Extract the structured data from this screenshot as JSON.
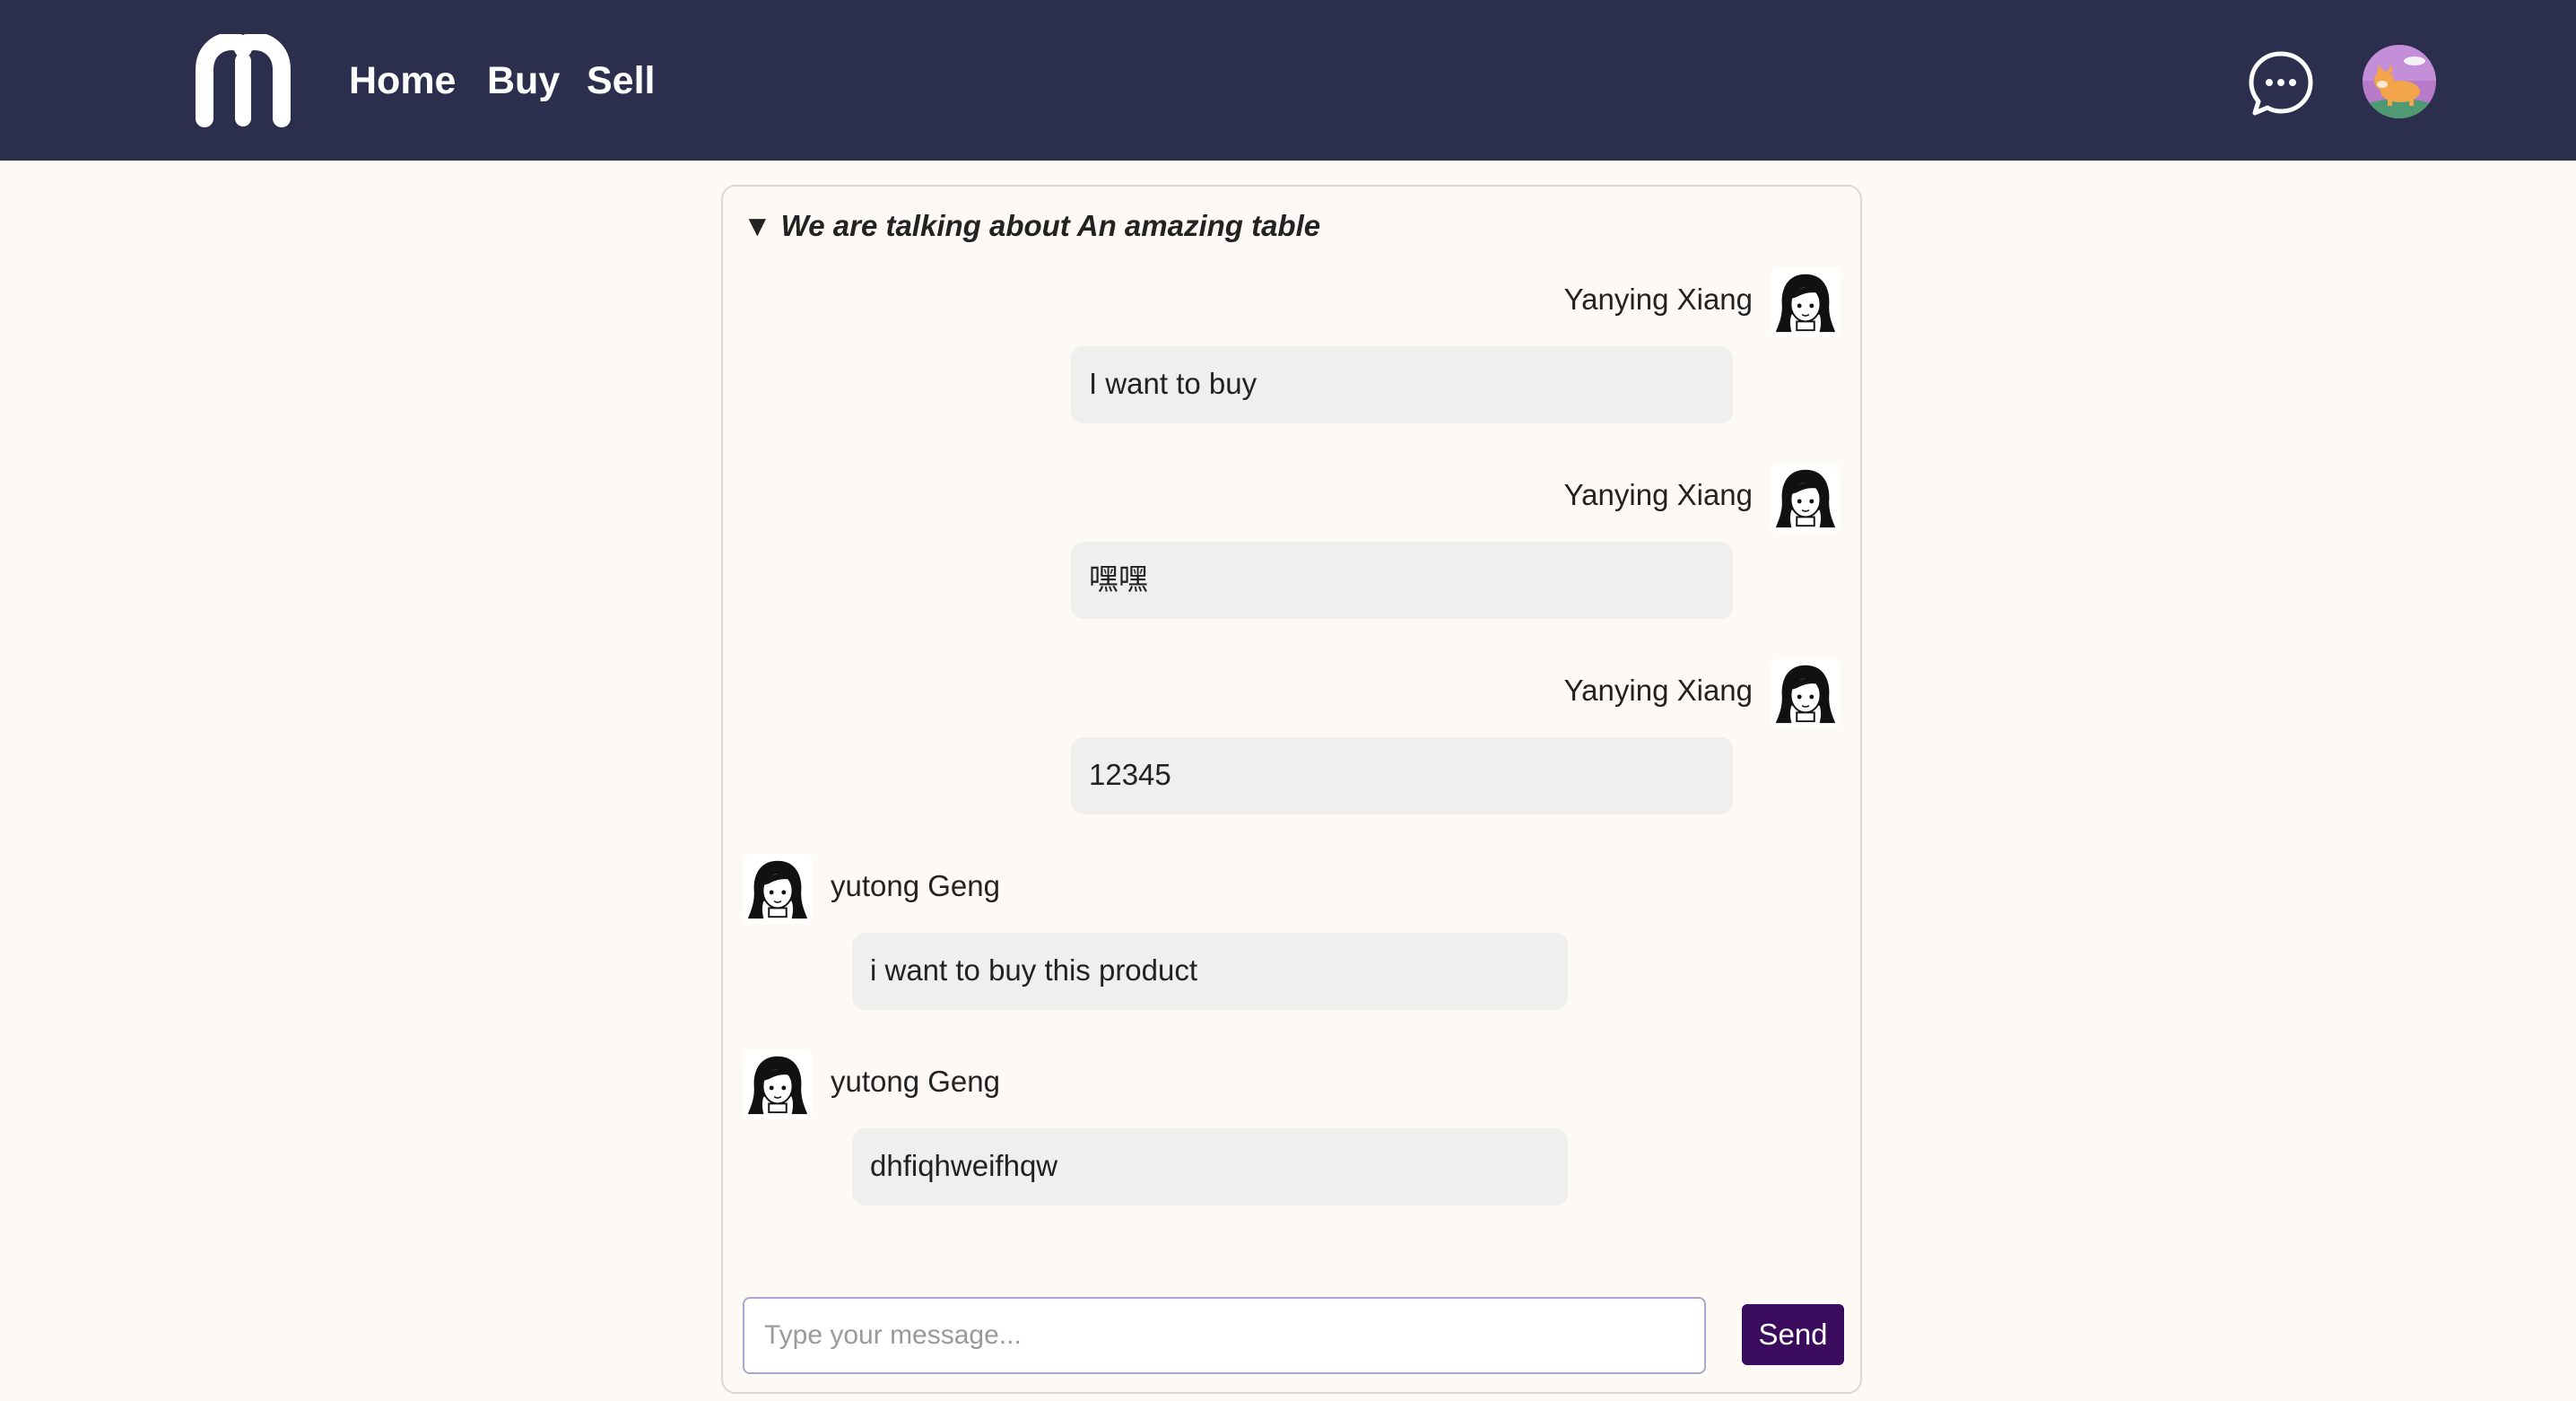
{
  "nav": {
    "links": [
      {
        "label": "Home"
      },
      {
        "label": "Buy"
      },
      {
        "label": "Sell"
      }
    ],
    "logo_icon": "m-logo-icon",
    "chat_icon": "chat-bubble-icon",
    "avatar_icon": "corgi-avatar"
  },
  "chat": {
    "title": "We are talking about An amazing table",
    "title_toggle": "▼",
    "messages": [
      {
        "sender": "Yanying Xiang",
        "text": "I want to buy",
        "side": "right"
      },
      {
        "sender": "Yanying Xiang",
        "text": "嘿嘿",
        "side": "right"
      },
      {
        "sender": "Yanying Xiang",
        "text": "12345",
        "side": "right"
      },
      {
        "sender": "yutong Geng",
        "text": "i want to buy this product",
        "side": "left"
      },
      {
        "sender": "yutong Geng",
        "text": "dhfiqhweifhqw",
        "side": "left"
      }
    ],
    "input": {
      "placeholder": "Type your message...",
      "value": ""
    },
    "send_label": "Send"
  },
  "colors": {
    "navbar": "#2c2e4d",
    "page_bg": "#fdfaf5",
    "bubble": "#efefef",
    "send_button": "#3b0c5e"
  }
}
